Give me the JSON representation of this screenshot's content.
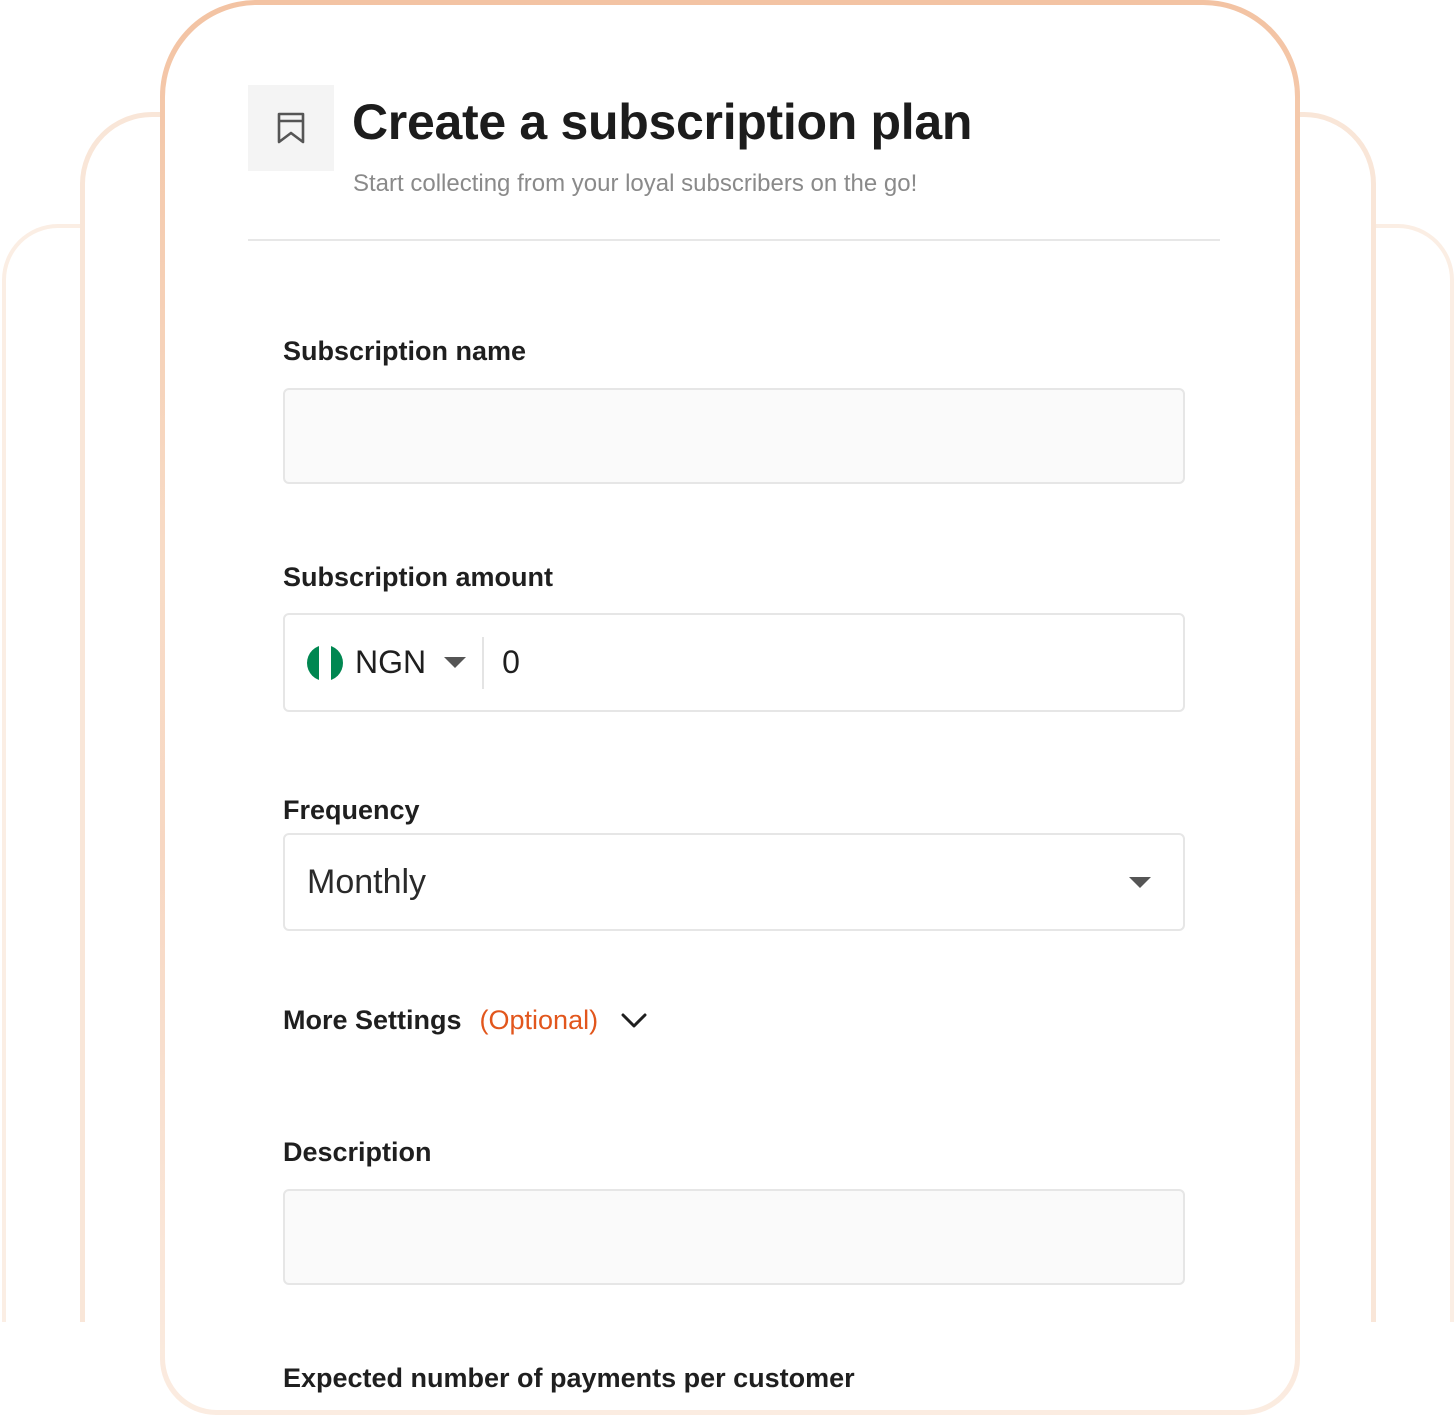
{
  "header": {
    "title": "Create a subscription plan",
    "subtitle": "Start collecting from your loyal subscribers on the go!",
    "icon": "bookmark-icon"
  },
  "form": {
    "name": {
      "label": "Subscription name",
      "value": ""
    },
    "amount": {
      "label": "Subscription amount",
      "currency": "NGN",
      "flag_colors": [
        "#008751",
        "#ffffff",
        "#008751"
      ],
      "value": "0"
    },
    "frequency": {
      "label": "Frequency",
      "selected": "Monthly"
    },
    "more_settings": {
      "label": "More Settings",
      "optional": "(Optional)",
      "icon": "chevron-down-icon"
    },
    "description": {
      "label": "Description",
      "value": ""
    },
    "expected_payments": {
      "label": "Expected number of payments per customer"
    }
  },
  "colors": {
    "accent": "#e2561c",
    "card_border": "#f3c3a3"
  }
}
